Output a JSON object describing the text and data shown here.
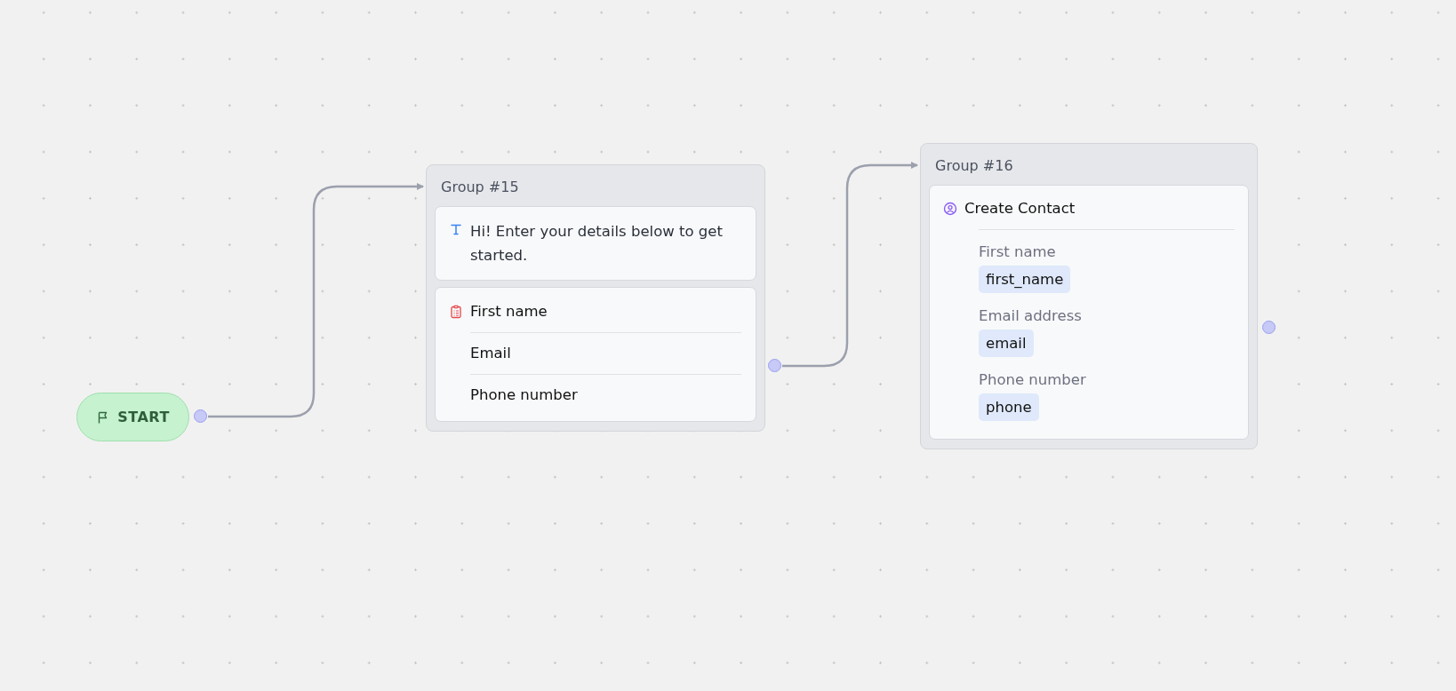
{
  "start": {
    "label": "START"
  },
  "groups": [
    {
      "title": "Group #15",
      "blocks": [
        {
          "kind": "text",
          "text": "Hi! Enter your details below to get started."
        },
        {
          "kind": "inputs",
          "items": [
            "First name",
            "Email",
            "Phone number"
          ]
        }
      ]
    },
    {
      "title": "Group #16",
      "blocks": [
        {
          "kind": "action",
          "title": "Create Contact",
          "fields": [
            {
              "label": "First name",
              "value": "first_name"
            },
            {
              "label": "Email address",
              "value": "email"
            },
            {
              "label": "Phone number",
              "value": "phone"
            }
          ]
        }
      ]
    }
  ]
}
